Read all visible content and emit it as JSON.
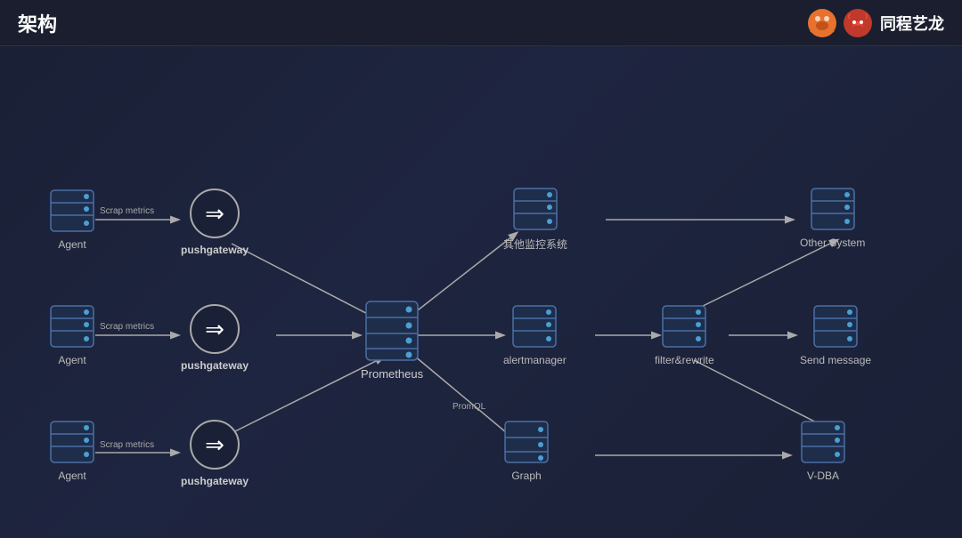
{
  "header": {
    "title": "架构",
    "logo_text": "同程艺龙"
  },
  "diagram": {
    "components": {
      "agent1": {
        "label": "Agent"
      },
      "agent2": {
        "label": "Agent"
      },
      "agent3": {
        "label": "Agent"
      },
      "pushgateway1": {
        "label": "pushgateway"
      },
      "pushgateway2": {
        "label": "pushgateway"
      },
      "pushgateway3": {
        "label": "pushgateway"
      },
      "prometheus": {
        "label": "Prometheus"
      },
      "other_monitor": {
        "label": "其他监控系统"
      },
      "alertmanager": {
        "label": "alertmanager"
      },
      "filter_rewrite": {
        "label": "filter&rewrite"
      },
      "other_system": {
        "label": "Other System"
      },
      "send_message": {
        "label": "Send message"
      },
      "graph": {
        "label": "Graph"
      },
      "vdba": {
        "label": "V-DBA"
      }
    },
    "arrow_labels": {
      "scrap1": "Scrap metrics",
      "scrap2": "Scrap metrics",
      "scrap3": "Scrap metrics",
      "promql": "PromQL"
    }
  }
}
